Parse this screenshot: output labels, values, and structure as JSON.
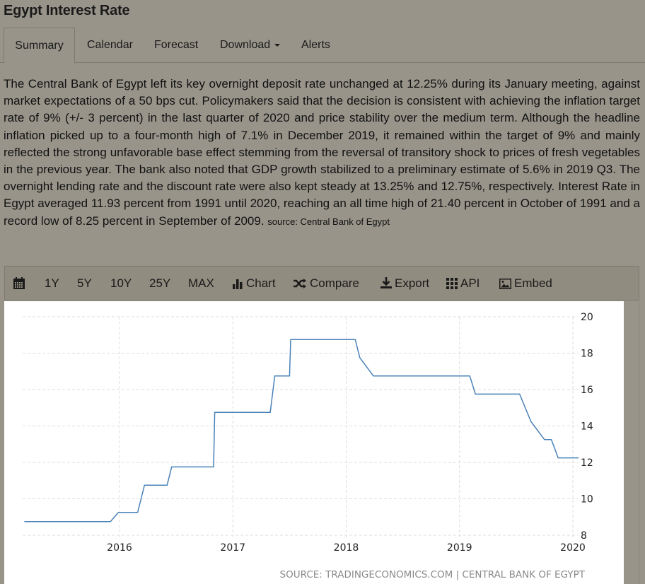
{
  "page": {
    "title": "Egypt Interest Rate"
  },
  "tabs": [
    {
      "label": "Summary",
      "active": true
    },
    {
      "label": "Calendar",
      "active": false
    },
    {
      "label": "Forecast",
      "active": false
    },
    {
      "label": "Download",
      "active": false,
      "has_dropdown": true
    },
    {
      "label": "Alerts",
      "active": false
    }
  ],
  "summary": {
    "text": "The Central Bank of Egypt left its key overnight deposit rate unchanged at 12.25% during its January meeting, against market expectations of a 50 bps cut. Policymakers said that the decision is consistent with achieving the inflation target rate of 9% (+/- 3 percent) in the last quarter of 2020 and price stability over the medium term. Although the headline inflation picked up to a four-month high of 7.1% in December 2019, it remained within the target of 9% and mainly reflected the strong unfavorable base effect stemming from the reversal of transitory shock to prices of fresh vegetables in the previous year. The bank also noted that GDP growth stabilized to a preliminary estimate of 5.6% in 2019 Q3. The overnight lending rate and the discount rate were also kept steady at 13.25% and 12.75%, respectively. Interest Rate in Egypt averaged 11.93 percent from 1991 until 2020, reaching an all time high of 21.40 percent in October of 1991 and a record low of 8.25 percent in September of 2009.",
    "source": "source: Central Bank of Egypt"
  },
  "toolbar": {
    "calendar_icon": "calendar-icon",
    "ranges": [
      "1Y",
      "5Y",
      "10Y",
      "25Y",
      "MAX"
    ],
    "chart_label": "Chart",
    "compare_label": "Compare",
    "export_label": "Export",
    "api_label": "API",
    "embed_label": "Embed"
  },
  "colors": {
    "line": "#4a82b8",
    "background": "#98948a",
    "chart_bg": "#ffffff",
    "grid": "#dddddd",
    "source_text": "#8a8a8a"
  },
  "chart_data": {
    "type": "line",
    "title": "",
    "xlabel": "",
    "ylabel": "",
    "ylim": [
      8,
      20
    ],
    "xlim": [
      2015.16,
      2020.05
    ],
    "grid": true,
    "yaxis_position": "right",
    "x_ticks": [
      2016,
      2017,
      2018,
      2019,
      2020
    ],
    "y_ticks": [
      8,
      10,
      12,
      14,
      16,
      18,
      20
    ],
    "source_label": "SOURCE: TRADINGECONOMICS.COM | CENTRAL BANK OF EGYPT",
    "series": [
      {
        "name": "Egypt Interest Rate",
        "x": [
          2015.16,
          2015.92,
          2015.99,
          2016.16,
          2016.22,
          2016.42,
          2016.46,
          2016.83,
          2016.84,
          2017.33,
          2017.37,
          2017.5,
          2017.51,
          2018.08,
          2018.12,
          2018.24,
          2019.09,
          2019.14,
          2019.53,
          2019.63,
          2019.75,
          2019.81,
          2019.87,
          2019.93,
          2020.05
        ],
        "values": [
          8.75,
          8.75,
          9.25,
          9.25,
          10.75,
          10.75,
          11.75,
          11.75,
          14.75,
          14.75,
          16.75,
          16.75,
          18.75,
          18.75,
          17.75,
          16.75,
          16.75,
          15.75,
          15.75,
          14.25,
          13.25,
          13.25,
          12.25,
          12.25,
          12.25
        ]
      }
    ]
  }
}
